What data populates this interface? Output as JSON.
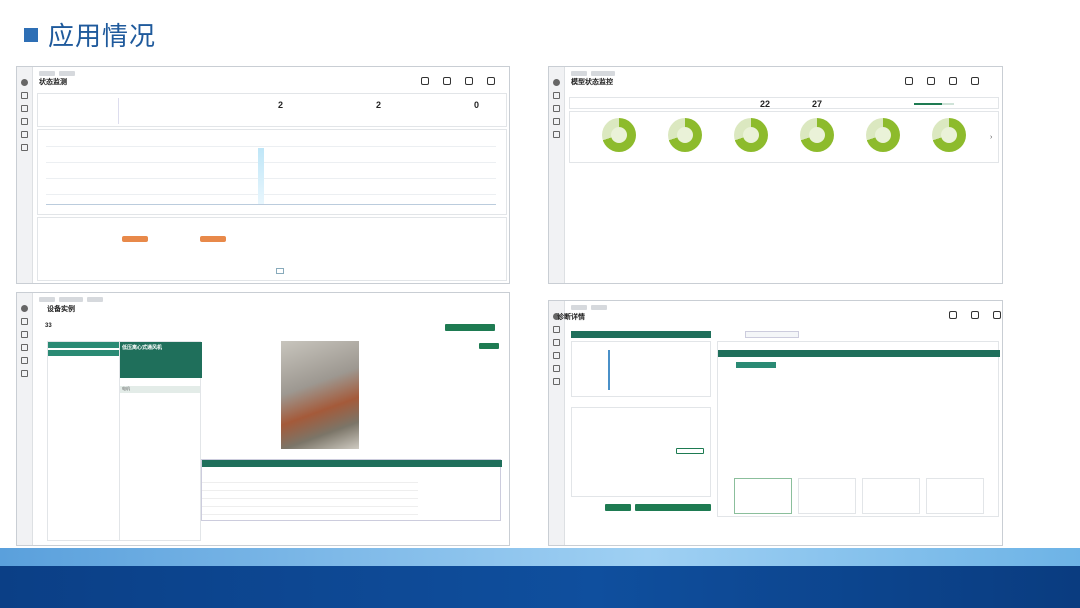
{
  "page": {
    "title": "应用情况"
  },
  "status_monitor": {
    "title": "状态监测",
    "stats": [
      {
        "value": "2"
      },
      {
        "value": "2"
      },
      {
        "value": "0"
      }
    ]
  },
  "model_monitor": {
    "title": "模型状态监控",
    "counts": [
      {
        "value": "22"
      },
      {
        "value": "27"
      }
    ]
  },
  "device_instance": {
    "title": "设备实例",
    "count": "33",
    "selected_title": "低压离心式通风机",
    "motor_label": "电机"
  },
  "diagnosis": {
    "title": "诊断详情"
  }
}
